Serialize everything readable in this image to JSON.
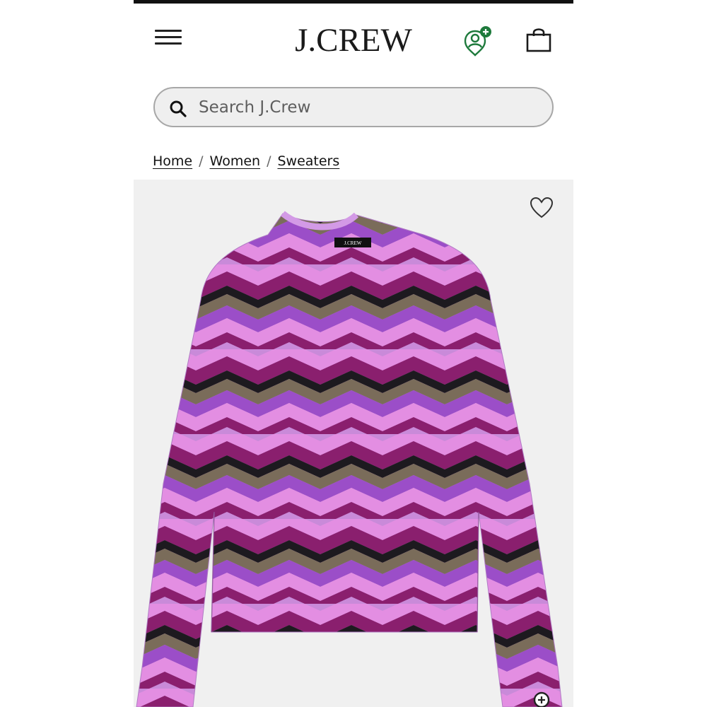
{
  "header": {
    "menu_icon": "hamburger-menu-icon",
    "logo_text": "J.CREW",
    "account_icon": "account-plus-icon",
    "bag_icon": "shopping-bag-icon",
    "accent_color": "#1e7a3c"
  },
  "search": {
    "icon": "search-icon",
    "placeholder": "Search J.Crew"
  },
  "breadcrumb": {
    "items": [
      "Home",
      "Women",
      "Sweaters"
    ],
    "separator": "/"
  },
  "product": {
    "image_icon": "sweater-image",
    "tag_label": "J.CREW",
    "wishlist_icon": "heart-icon",
    "zoom_icon": "zoom-in-icon",
    "colors": [
      "#e38ee2",
      "#9b4ec8",
      "#8a1f6e",
      "#7a6c5a",
      "#1d1a1f",
      "#c98ad9"
    ]
  }
}
